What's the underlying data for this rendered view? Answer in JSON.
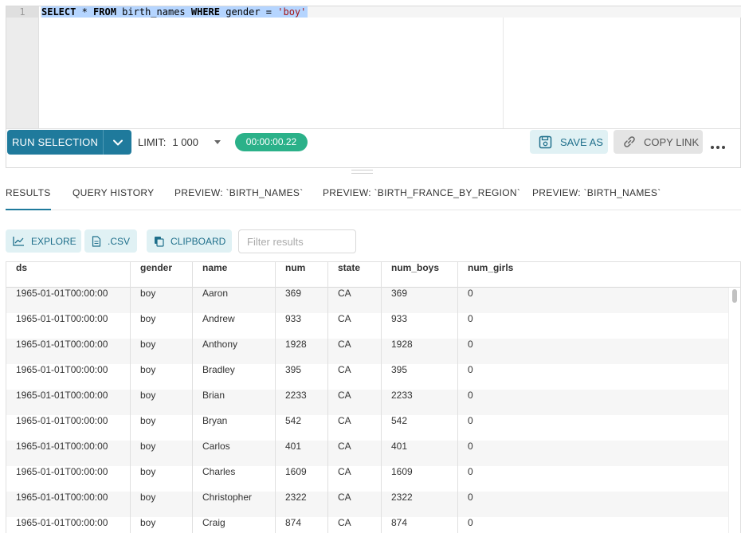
{
  "editor": {
    "line_number": "1",
    "query_parts": [
      {
        "text": "SELECT",
        "kind": "kw"
      },
      {
        "text": " * ",
        "kind": "plain"
      },
      {
        "text": "FROM",
        "kind": "kw"
      },
      {
        "text": " birth_names ",
        "kind": "plain"
      },
      {
        "text": "WHERE",
        "kind": "kw"
      },
      {
        "text": " gender = ",
        "kind": "plain"
      },
      {
        "text": "'boy'",
        "kind": "str"
      }
    ]
  },
  "toolbar": {
    "run_label": "RUN SELECTION",
    "limit_label": "LIMIT:",
    "limit_value": "1 000",
    "timer": "00:00:00.22",
    "save_label": "SAVE AS",
    "copy_label": "COPY LINK"
  },
  "tabs": [
    {
      "label": "RESULTS",
      "active": true
    },
    {
      "label": "QUERY HISTORY",
      "active": false
    },
    {
      "label": "PREVIEW: `BIRTH_NAMES`",
      "active": false
    },
    {
      "label": "PREVIEW: `BIRTH_FRANCE_BY_REGION`",
      "active": false
    },
    {
      "label": "PREVIEW: `BIRTH_NAMES`",
      "active": false
    }
  ],
  "actions": {
    "explore_label": "EXPLORE",
    "csv_label": ".CSV",
    "clipboard_label": "CLIPBOARD",
    "filter_placeholder": "Filter results"
  },
  "table": {
    "columns": [
      "ds",
      "gender",
      "name",
      "num",
      "state",
      "num_boys",
      "num_girls"
    ],
    "rows": [
      [
        "1965-01-01T00:00:00",
        "boy",
        "Aaron",
        "369",
        "CA",
        "369",
        "0"
      ],
      [
        "1965-01-01T00:00:00",
        "boy",
        "Andrew",
        "933",
        "CA",
        "933",
        "0"
      ],
      [
        "1965-01-01T00:00:00",
        "boy",
        "Anthony",
        "1928",
        "CA",
        "1928",
        "0"
      ],
      [
        "1965-01-01T00:00:00",
        "boy",
        "Bradley",
        "395",
        "CA",
        "395",
        "0"
      ],
      [
        "1965-01-01T00:00:00",
        "boy",
        "Brian",
        "2233",
        "CA",
        "2233",
        "0"
      ],
      [
        "1965-01-01T00:00:00",
        "boy",
        "Bryan",
        "542",
        "CA",
        "542",
        "0"
      ],
      [
        "1965-01-01T00:00:00",
        "boy",
        "Carlos",
        "401",
        "CA",
        "401",
        "0"
      ],
      [
        "1965-01-01T00:00:00",
        "boy",
        "Charles",
        "1609",
        "CA",
        "1609",
        "0"
      ],
      [
        "1965-01-01T00:00:00",
        "boy",
        "Christopher",
        "2322",
        "CA",
        "2322",
        "0"
      ],
      [
        "1965-01-01T00:00:00",
        "boy",
        "Craig",
        "874",
        "CA",
        "874",
        "0"
      ]
    ]
  },
  "colors": {
    "primary": "#1f7a9c",
    "timer_bg": "#2bb189",
    "action_bg": "#e0f1f4"
  }
}
